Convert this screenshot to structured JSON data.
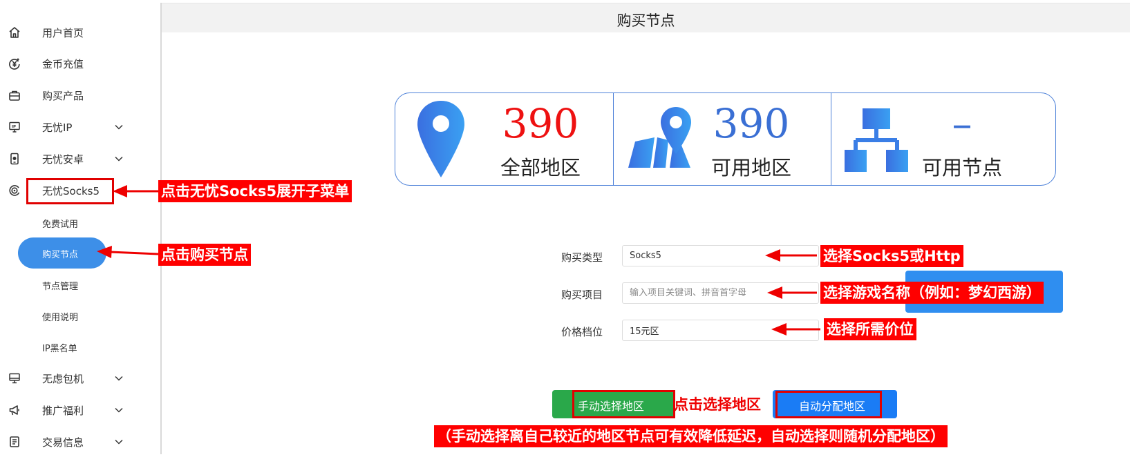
{
  "sidebar": {
    "items": [
      {
        "label": "用户首页",
        "icon": "home-icon"
      },
      {
        "label": "金币充值",
        "icon": "coin-recharge-icon"
      },
      {
        "label": "购买产品",
        "icon": "shopping-bag-icon"
      },
      {
        "label": "无忧IP",
        "icon": "ip-monitor-icon"
      },
      {
        "label": "无忧安卓",
        "icon": "android-phone-icon"
      },
      {
        "label": "无忧Socks5",
        "icon": "socks-target-icon"
      },
      {
        "label": "无虑包机",
        "icon": "desktop-icon"
      },
      {
        "label": "推广福利",
        "icon": "megaphone-icon"
      },
      {
        "label": "交易信息",
        "icon": "document-list-icon"
      }
    ],
    "submenu": [
      "免费试用",
      "购买节点",
      "节点管理",
      "使用说明",
      "IP黑名单"
    ],
    "active_sub": "购买节点"
  },
  "header": {
    "title": "购买节点"
  },
  "stats": [
    {
      "value": "390",
      "label": "全部地区",
      "color": "#ee1111",
      "icon": "location-pin-icon"
    },
    {
      "value": "390",
      "label": "可用地区",
      "color": "#3a6fd4",
      "icon": "map-location-icon"
    },
    {
      "value": "–",
      "label": "可用节点",
      "color": "#3a6fd4",
      "icon": "network-tree-icon"
    }
  ],
  "form": {
    "type_label": "购买类型",
    "type_value": "Socks5",
    "project_label": "购买项目",
    "project_placeholder": "输入项目关键词、拼音首字母",
    "price_label": "价格档位",
    "price_value": "15元区"
  },
  "buttons": {
    "manual": "手动选择地区",
    "auto": "自动分配地区"
  },
  "annotations": {
    "expand_socks": "点击无忧Socks5展开子菜单",
    "click_buy": "点击购买节点",
    "choose_type": "选择Socks5或Http",
    "choose_game": "选择游戏名称（例如：梦幻西游）",
    "choose_price": "选择所需价位",
    "choose_region": "点击选择地区",
    "note": "（手动选择离自己较近的地区节点可有效降低延迟，自动选择则随机分配地区）"
  },
  "colors": {
    "accent": "#3d8fe8",
    "annotation": "#ff0000",
    "green": "#2aa84a",
    "blue": "#1a7cf5"
  }
}
